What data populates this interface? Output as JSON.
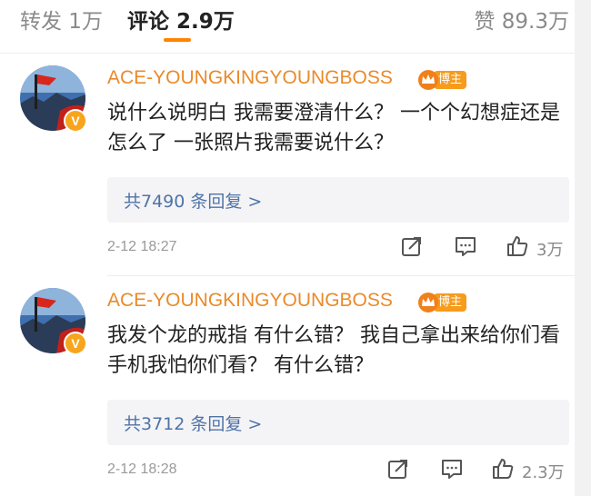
{
  "tabs": {
    "repost": "转发 1万",
    "comments": "评论 2.9万",
    "likes": "赞 89.3万"
  },
  "accent_color": "#ff8200",
  "comments": [
    {
      "username": "ACE-YOUNGKINGYOUNGBOSS",
      "badge": "博主",
      "verified_mark": "V",
      "avatar_icon": "avatar-icon",
      "text": "说什么说明白 我需要澄清什么？ 一个个幻想症还是怎么了 一张照片我需要说什么？",
      "replies": "共7490 条回复 >",
      "time": "2-12 18:27",
      "likes": "3万"
    },
    {
      "username": "ACE-YOUNGKINGYOUNGBOSS",
      "badge": "博主",
      "verified_mark": "V",
      "avatar_icon": "avatar-icon",
      "text": "我发个龙的戒指 有什么错？ 我自己拿出来给你们看手机我怕你们看？ 有什么错？",
      "replies": "共3712 条回复 >",
      "time": "2-12 18:28",
      "likes": "2.3万"
    }
  ]
}
